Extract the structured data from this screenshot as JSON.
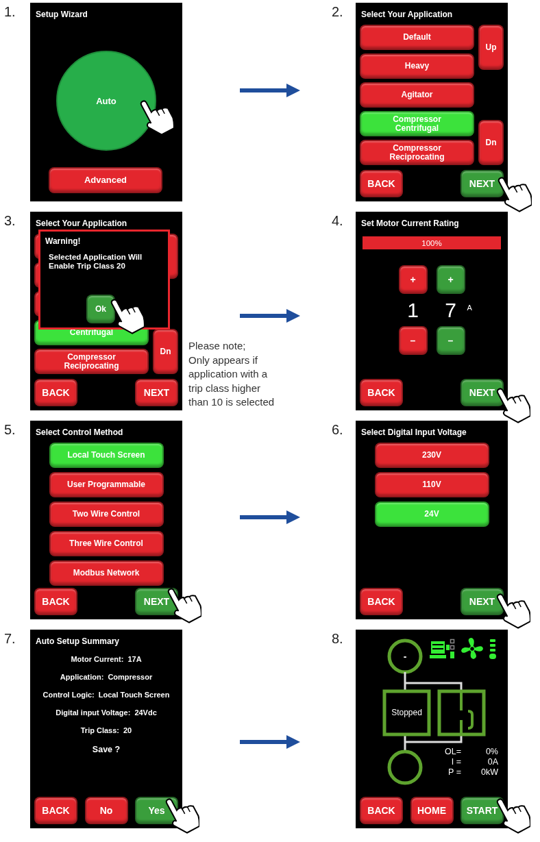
{
  "steps": [
    {
      "number": "1.",
      "kind": "wizard",
      "title": "Setup Wizard",
      "auto_button": "Auto",
      "advanced_button": "Advanced"
    },
    {
      "number": "2.",
      "kind": "list_updown",
      "title": "Select Your Application",
      "items": [
        {
          "label": "Default",
          "selected": false
        },
        {
          "label": "Heavy",
          "selected": false
        },
        {
          "label": "Agitator",
          "selected": false
        },
        {
          "label": "Compressor\nCentrifugal",
          "selected": true
        },
        {
          "label": "Compressor\nReciprocating",
          "selected": false
        }
      ],
      "up": "Up",
      "down": "Dn",
      "nav": [
        {
          "label": "BACK",
          "color": "#e3262d"
        },
        {
          "label": "NEXT",
          "color": "#3a9e3c"
        }
      ]
    },
    {
      "number": "3.",
      "kind": "warning",
      "title": "Select Your Application",
      "dialog": {
        "title": "Warning!",
        "message": "Selected Application Will\nEnable Trip Class 20",
        "button": "Ok"
      },
      "items": [
        {
          "label": "Centrifugal",
          "selected": true
        },
        {
          "label": "Compressor\nReciprocating",
          "selected": false
        }
      ],
      "down": "Dn",
      "nav": [
        {
          "label": "BACK",
          "color": "#e3262d"
        },
        {
          "label": "NEXT",
          "color": "#e3262d"
        }
      ],
      "note_lines": [
        "Please note;",
        "Only appears if",
        "application with a",
        "trip class higher",
        "than 10 is selected"
      ]
    },
    {
      "number": "4.",
      "kind": "current",
      "title": "Set Motor Current Rating",
      "bar": {
        "label": "100%"
      },
      "digits": [
        {
          "plus": "+",
          "value": "1",
          "minus": "–",
          "color": "#e3262d"
        },
        {
          "plus": "+",
          "value": "7",
          "minus": "–",
          "color": "#3a9e3c"
        }
      ],
      "unit": "A",
      "nav": [
        {
          "label": "BACK",
          "color": "#e3262d"
        },
        {
          "label": "NEXT",
          "color": "#3a9e3c"
        }
      ]
    },
    {
      "number": "5.",
      "kind": "list",
      "title": "Select Control Method",
      "items": [
        {
          "label": "Local Touch Screen",
          "selected": true
        },
        {
          "label": "User Programmable",
          "selected": false
        },
        {
          "label": "Two Wire Control",
          "selected": false
        },
        {
          "label": "Three Wire Control",
          "selected": false
        },
        {
          "label": "Modbus Network",
          "selected": false
        }
      ],
      "nav": [
        {
          "label": "BACK",
          "color": "#e3262d"
        },
        {
          "label": "NEXT",
          "color": "#3a9e3c"
        }
      ]
    },
    {
      "number": "6.",
      "kind": "list",
      "title": "Select Digital Input Voltage",
      "items": [
        {
          "label": "230V",
          "selected": false
        },
        {
          "label": "110V",
          "selected": false
        },
        {
          "label": "24V",
          "selected": true
        }
      ],
      "nav": [
        {
          "label": "BACK",
          "color": "#e3262d"
        },
        {
          "label": "NEXT",
          "color": "#3a9e3c"
        }
      ]
    },
    {
      "number": "7.",
      "kind": "summary",
      "title": "Auto Setup Summary",
      "rows": [
        {
          "label": "Motor Current:",
          "value": "17A"
        },
        {
          "label": "Application:",
          "value": "Compressor"
        },
        {
          "label": "Control Logic:",
          "value": "Local Touch Screen"
        },
        {
          "label": "Digital input Voltage:",
          "value": "24Vdc"
        },
        {
          "label": "Trip Class:",
          "value": "20"
        }
      ],
      "question": "Save ?",
      "nav": [
        {
          "label": "BACK",
          "color": "#e3262d"
        },
        {
          "label": "No",
          "color": "#e3262d"
        },
        {
          "label": "Yes",
          "color": "#3a9e3c"
        }
      ]
    },
    {
      "number": "8.",
      "kind": "status",
      "top_symbol": "-",
      "state": "Stopped",
      "readings": [
        {
          "label": "OL=",
          "value": "0%"
        },
        {
          "label": "I =",
          "value": "0A"
        },
        {
          "label": "P =",
          "value": "0kW"
        }
      ],
      "nav": [
        {
          "label": "BACK",
          "color": "#e3262d"
        },
        {
          "label": "HOME",
          "color": "#e3262d"
        },
        {
          "label": "START",
          "color": "#3a9e3c"
        }
      ]
    }
  ]
}
